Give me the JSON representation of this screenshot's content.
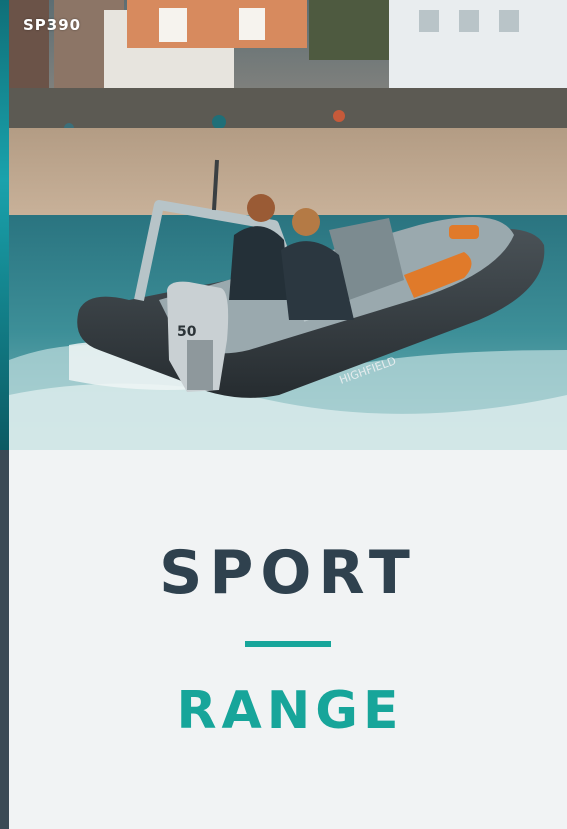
{
  "cover": {
    "model_tag": "SP390",
    "title": "SPORT",
    "subtitle": "RANGE"
  },
  "photo": {
    "engine_label": "50",
    "hull_brand": "HIGHFIELD"
  },
  "colors": {
    "title": "#2f414e",
    "accent": "#17a59a",
    "panel_background": "#f1f3f4",
    "edge_stripe": "#3b4a55"
  }
}
